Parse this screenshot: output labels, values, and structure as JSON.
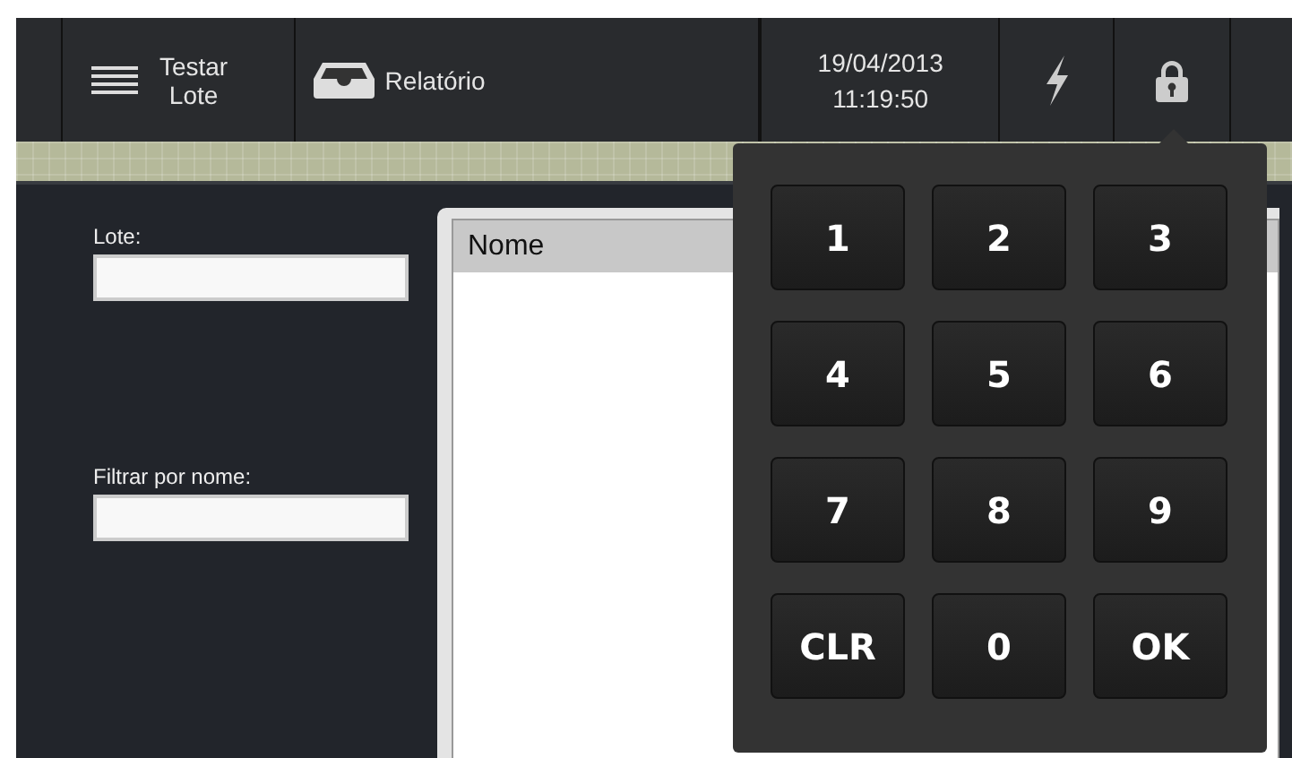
{
  "toolbar": {
    "batch_button": {
      "label_line_1": "Testar",
      "label_line_2": "Lote"
    },
    "report_button": {
      "label": "Relatório"
    },
    "date": "19/04/2013",
    "time": "11:19:50"
  },
  "form": {
    "batch_label": "Lote:",
    "filter_label": "Filtrar por nome:"
  },
  "list": {
    "columns": [
      "Nome"
    ]
  },
  "keypad": {
    "keys": [
      "1",
      "2",
      "3",
      "4",
      "5",
      "6",
      "7",
      "8",
      "9",
      "CLR",
      "0",
      "OK"
    ]
  }
}
